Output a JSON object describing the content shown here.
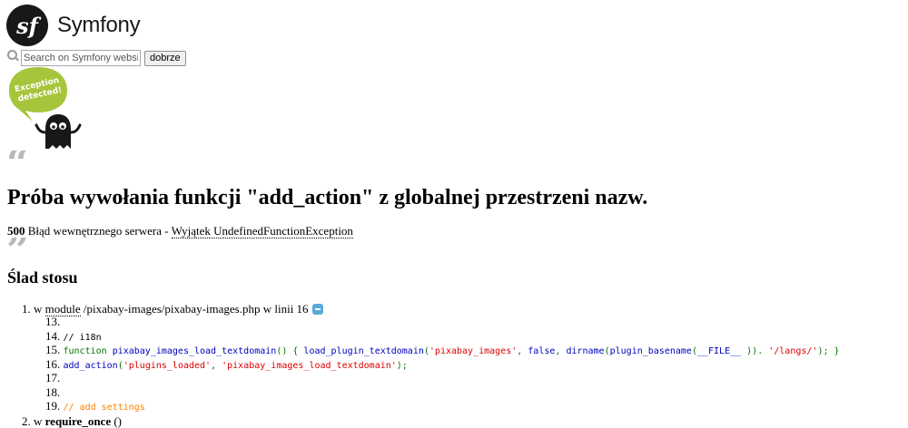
{
  "brand": {
    "logo_glyph": "sf",
    "name": "Symfony",
    "color": "#1a171b"
  },
  "search": {
    "placeholder": "Search on Symfony websit",
    "button_label": "dobrze"
  },
  "illustration": {
    "bubble_text_line1": "Exception",
    "bubble_text_line2": "detected!",
    "bubble_color": "#a6c53b",
    "ghost_color": "#1a171b"
  },
  "error": {
    "title": "Próba wywołania funkcji \"add_action\" z globalnej przestrzeni nazw.",
    "status_code": "500",
    "status_text": "Błąd wewnętrznego serwera - ",
    "exception_class": "Wyjątek UndefinedFunctionException"
  },
  "trace": {
    "heading": "Ślad stosu",
    "items": [
      {
        "number": "1.",
        "prefix": "w ",
        "kind": "module",
        "path": " /pixabay-images/pixabay-images.php w linii 16",
        "code_lines": [
          {
            "num": "13.",
            "parts": []
          },
          {
            "num": "14.",
            "parts": [
              {
                "t": "plain",
                "v": "// i18n"
              }
            ]
          },
          {
            "num": "15.",
            "parts": [
              {
                "t": "kw",
                "v": "function "
              },
              {
                "t": "fn",
                "v": "pixabay_images_load_textdomain"
              },
              {
                "t": "kw",
                "v": "() { "
              },
              {
                "t": "fn",
                "v": "load_plugin_textdomain"
              },
              {
                "t": "kw",
                "v": "("
              },
              {
                "t": "str",
                "v": "'pixabay_images'"
              },
              {
                "t": "kw",
                "v": ", "
              },
              {
                "t": "fn",
                "v": "false"
              },
              {
                "t": "kw",
                "v": ", "
              },
              {
                "t": "fn",
                "v": "dirname"
              },
              {
                "t": "kw",
                "v": "("
              },
              {
                "t": "fn",
                "v": "plugin_basename"
              },
              {
                "t": "kw",
                "v": "("
              },
              {
                "t": "fn",
                "v": "__FILE__"
              },
              {
                "t": "kw",
                "v": " )). "
              },
              {
                "t": "str",
                "v": "'/langs/'"
              },
              {
                "t": "kw",
                "v": "); }"
              }
            ]
          },
          {
            "num": "16.",
            "parts": [
              {
                "t": "fn",
                "v": "add_action"
              },
              {
                "t": "kw",
                "v": "("
              },
              {
                "t": "str",
                "v": "'plugins_loaded'"
              },
              {
                "t": "kw",
                "v": ", "
              },
              {
                "t": "str",
                "v": "'pixabay_images_load_textdomain'"
              },
              {
                "t": "kw",
                "v": ");"
              }
            ]
          },
          {
            "num": "17.",
            "parts": []
          },
          {
            "num": "18.",
            "parts": []
          },
          {
            "num": "19.",
            "parts": [
              {
                "t": "cm",
                "v": "// add settings"
              }
            ]
          }
        ]
      },
      {
        "number": "2.",
        "prefix": "w ",
        "kind": "require_once",
        "path": " ()",
        "code_lines": []
      }
    ]
  }
}
